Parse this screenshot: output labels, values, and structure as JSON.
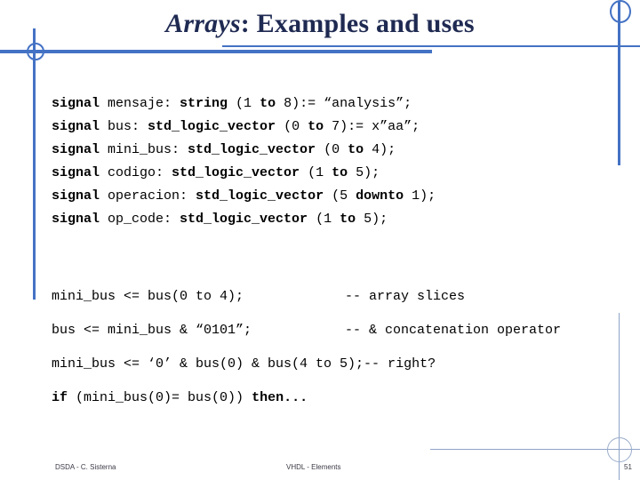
{
  "slide": {
    "title": {
      "emphasis": "Arrays",
      "rest": ": Examples and uses"
    },
    "declarations": [
      {
        "id": "decl-mensaje",
        "segments": [
          {
            "t": "signal ",
            "bold": true
          },
          {
            "t": "mensaje: ",
            "bold": false
          },
          {
            "t": "string ",
            "bold": true
          },
          {
            "t": "(1 ",
            "bold": false
          },
          {
            "t": "to ",
            "bold": true
          },
          {
            "t": "8):= “analysis”;",
            "bold": false
          }
        ],
        "plain": "signal mensaje: string (1 to 8):= “analysis”;"
      },
      {
        "id": "decl-bus",
        "segments": [
          {
            "t": "signal ",
            "bold": true
          },
          {
            "t": "bus: ",
            "bold": false
          },
          {
            "t": "std_logic_vector ",
            "bold": true
          },
          {
            "t": "(0 ",
            "bold": false
          },
          {
            "t": "to ",
            "bold": true
          },
          {
            "t": "7):= x”aa”;",
            "bold": false
          }
        ],
        "plain": "signal bus: std_logic_vector (0 to 7):= x”aa”;"
      },
      {
        "id": "decl-mini-bus",
        "segments": [
          {
            "t": "signal ",
            "bold": true
          },
          {
            "t": "mini_bus: ",
            "bold": false
          },
          {
            "t": "std_logic_vector ",
            "bold": true
          },
          {
            "t": "(0 ",
            "bold": false
          },
          {
            "t": "to ",
            "bold": true
          },
          {
            "t": "4);",
            "bold": false
          }
        ],
        "plain": "signal mini_bus: std_logic_vector (0 to 4);"
      },
      {
        "id": "decl-codigo",
        "segments": [
          {
            "t": "signal ",
            "bold": true
          },
          {
            "t": "codigo: ",
            "bold": false
          },
          {
            "t": "std_logic_vector ",
            "bold": true
          },
          {
            "t": "(1 ",
            "bold": false
          },
          {
            "t": "to ",
            "bold": true
          },
          {
            "t": "5);",
            "bold": false
          }
        ],
        "plain": "signal codigo: std_logic_vector (1 to 5);"
      },
      {
        "id": "decl-operacion",
        "segments": [
          {
            "t": "signal ",
            "bold": true
          },
          {
            "t": "operacion: ",
            "bold": false
          },
          {
            "t": "std_logic_vector ",
            "bold": true
          },
          {
            "t": "(5 ",
            "bold": false
          },
          {
            "t": "downto ",
            "bold": true
          },
          {
            "t": "1);",
            "bold": false
          }
        ],
        "plain": "signal operacion: std_logic_vector (5 downto 1);"
      },
      {
        "id": "decl-op-code",
        "segments": [
          {
            "t": "signal ",
            "bold": true
          },
          {
            "t": "op_code: ",
            "bold": false
          },
          {
            "t": "std_logic_vector ",
            "bold": true
          },
          {
            "t": "(1 ",
            "bold": false
          },
          {
            "t": "to ",
            "bold": true
          },
          {
            "t": "5);",
            "bold": false
          }
        ],
        "plain": "signal op_code: std_logic_vector (1 to 5);"
      }
    ],
    "statements": [
      {
        "id": "stmt-slice",
        "code": "mini_bus <= bus(0 to 4);",
        "comment": "-- array slices"
      },
      {
        "id": "stmt-concat",
        "code": "bus <= mini_bus & “0101”;",
        "comment": "-- & concatenation operator"
      },
      {
        "id": "stmt-right",
        "code": "mini_bus <= ‘0’ & bus(0) & bus(4 to 5);-- right?",
        "comment": ""
      }
    ],
    "if_statement": {
      "id": "stmt-if",
      "keyword_if": "if ",
      "condition": "(mini_bus(0)= bus(0)) ",
      "keyword_then": "then..."
    },
    "footer": {
      "left": "DSDA - C. Sisterna",
      "middle": "VHDL - Elements",
      "page": "51"
    },
    "colors": {
      "accent_blue": "#4472C4",
      "light_blue": "#8FA4C8",
      "title_navy": "#1F2A52",
      "code_black": "#000000",
      "footer_gray": "#3A3A46",
      "background": "#FFFFFF"
    }
  }
}
